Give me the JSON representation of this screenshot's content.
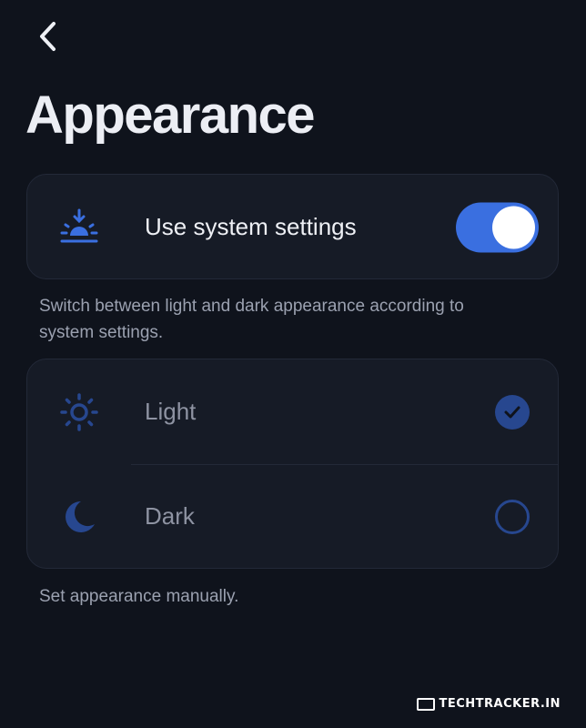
{
  "header": {
    "back_icon": "chevron-left-icon",
    "title": "Appearance"
  },
  "system_card": {
    "icon": "sunset-icon",
    "label": "Use system settings",
    "toggle_on": true,
    "description": "Switch between light and dark appearance according to system settings."
  },
  "options_card": {
    "light": {
      "icon": "sun-icon",
      "label": "Light",
      "selected": true
    },
    "dark": {
      "icon": "moon-icon",
      "label": "Dark",
      "selected": false
    },
    "description": "Set appearance manually."
  },
  "colors": {
    "background": "#0f131c",
    "card": "#161b26",
    "accent": "#3a6fe0",
    "muted_accent": "#27478f"
  },
  "watermark": {
    "text": "TECHTRACKER.IN"
  }
}
